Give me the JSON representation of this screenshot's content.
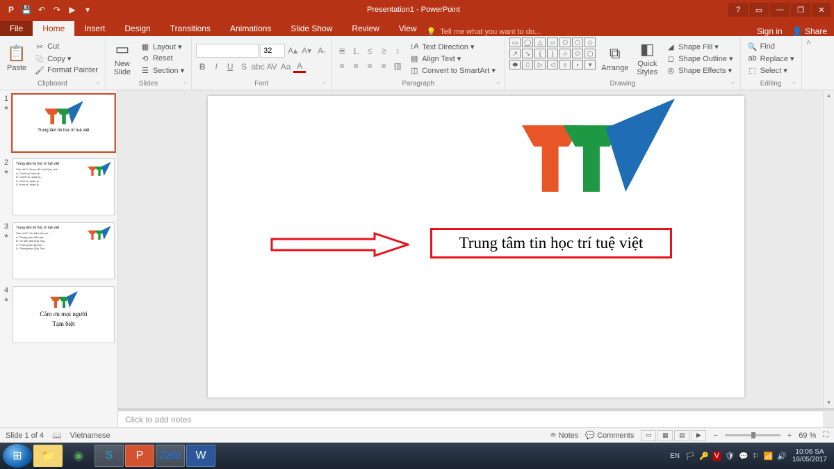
{
  "title": "Presentation1 - PowerPoint",
  "qat": {
    "save": "💾",
    "undo": "↶",
    "redo": "↷",
    "start": "▶"
  },
  "win": {
    "help": "?",
    "opts": "▭",
    "min": "—",
    "max": "❐",
    "close": "✕"
  },
  "tabs": {
    "file": "File",
    "home": "Home",
    "insert": "Insert",
    "design": "Design",
    "transitions": "Transitions",
    "animations": "Animations",
    "slideshow": "Slide Show",
    "review": "Review",
    "view": "View",
    "tellme": "Tell me what you want to do...",
    "signin": "Sign in",
    "share": "Share"
  },
  "ribbon": {
    "clipboard": {
      "paste": "Paste",
      "cut": "Cut",
      "copy": "Copy ▾",
      "painter": "Format Painter",
      "label": "Clipboard"
    },
    "slides": {
      "new": "New\nSlide",
      "layout": "Layout ▾",
      "reset": "Reset",
      "section": "Section ▾",
      "label": "Slides"
    },
    "font": {
      "size": "32",
      "label": "Font"
    },
    "paragraph": {
      "textdir": "Text Direction ▾",
      "align": "Align Text ▾",
      "smartart": "Convert to SmartArt ▾",
      "label": "Paragraph"
    },
    "drawing": {
      "arrange": "Arrange",
      "quick": "Quick\nStyles",
      "fill": "Shape Fill ▾",
      "outline": "Shape Outline ▾",
      "effects": "Shape Effects ▾",
      "label": "Drawing"
    },
    "editing": {
      "find": "Find",
      "replace": "Replace ▾",
      "select": "Select ▾",
      "label": "Editing"
    }
  },
  "thumbs": {
    "t1": {
      "title": "Trung tâm tin học trí tuệ việt"
    },
    "t4": {
      "line1": "Cảm ơn mọi người",
      "line2": "Tạm biệt"
    }
  },
  "slide": {
    "textbox": "Trung tâm tin học trí tuệ việt"
  },
  "notes_placeholder": "Click to add notes",
  "status": {
    "slide": "Slide 1 of 4",
    "lang": "Vietnamese",
    "notes": "Notes",
    "comments": "Comments",
    "zoom": "69 %"
  },
  "taskbar": {
    "lang": "EN",
    "time": "10:06 SA",
    "date": "16/05/2017"
  }
}
